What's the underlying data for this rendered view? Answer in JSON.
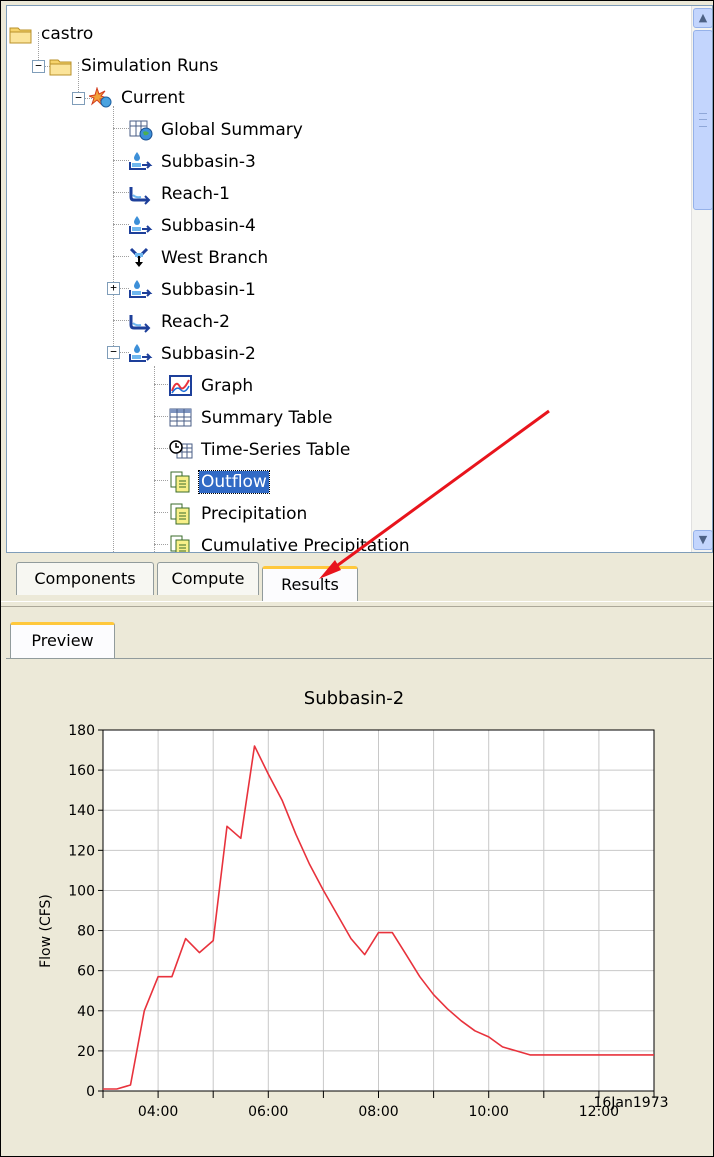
{
  "tree": {
    "root": "castro",
    "simulation_runs": "Simulation Runs",
    "current": "Current",
    "items": [
      "Global Summary",
      "Subbasin-3",
      "Reach-1",
      "Subbasin-4",
      "West Branch",
      "Subbasin-1",
      "Reach-2",
      "Subbasin-2"
    ],
    "subbasin2_items": [
      "Graph",
      "Summary Table",
      "Time-Series Table",
      "Outflow",
      "Precipitation",
      "Cumulative Precipitation"
    ],
    "selected": "Outflow"
  },
  "tabs": [
    "Components",
    "Compute",
    "Results"
  ],
  "active_tab": "Results",
  "preview_tab": "Preview",
  "colors": {
    "accent": "#316ac5",
    "series": "#e8323c",
    "tab_highlight": "#ffc83c",
    "annotation_arrow": "#e8141c"
  },
  "chart_data": {
    "type": "line",
    "title": "Subbasin-2",
    "ylabel": "Flow (CFS)",
    "xlabel": "",
    "date_label": "16Jan1973",
    "x_ticks": [
      "04:00",
      "06:00",
      "08:00",
      "10:00",
      "12:00"
    ],
    "y_ticks": [
      0,
      20,
      40,
      60,
      80,
      100,
      120,
      140,
      160,
      180
    ],
    "xlim": [
      "03:00",
      "13:00"
    ],
    "ylim": [
      0,
      180
    ],
    "grid": true,
    "series": [
      {
        "x": [
          "03:00",
          "03:15",
          "03:30",
          "03:45",
          "04:00",
          "04:15",
          "04:30",
          "04:45",
          "05:00",
          "05:15",
          "05:30",
          "05:45",
          "06:00",
          "06:15",
          "06:30",
          "06:45",
          "07:00",
          "07:15",
          "07:30",
          "07:45",
          "08:00",
          "08:15",
          "08:30",
          "08:45",
          "09:00",
          "09:15",
          "09:30",
          "09:45",
          "10:00",
          "10:15",
          "10:30",
          "10:45",
          "11:00",
          "11:15",
          "11:30",
          "11:45",
          "12:00",
          "12:15",
          "12:30",
          "12:45",
          "13:00"
        ],
        "y": [
          1,
          1,
          3,
          40,
          57,
          57,
          76,
          69,
          75,
          132,
          126,
          172,
          158,
          145,
          128,
          113,
          100,
          88,
          76,
          68,
          79,
          79,
          68,
          57,
          48,
          41,
          35,
          30,
          27,
          22,
          20,
          18,
          18,
          18,
          18,
          18,
          18,
          18,
          18,
          18,
          18
        ]
      }
    ]
  }
}
